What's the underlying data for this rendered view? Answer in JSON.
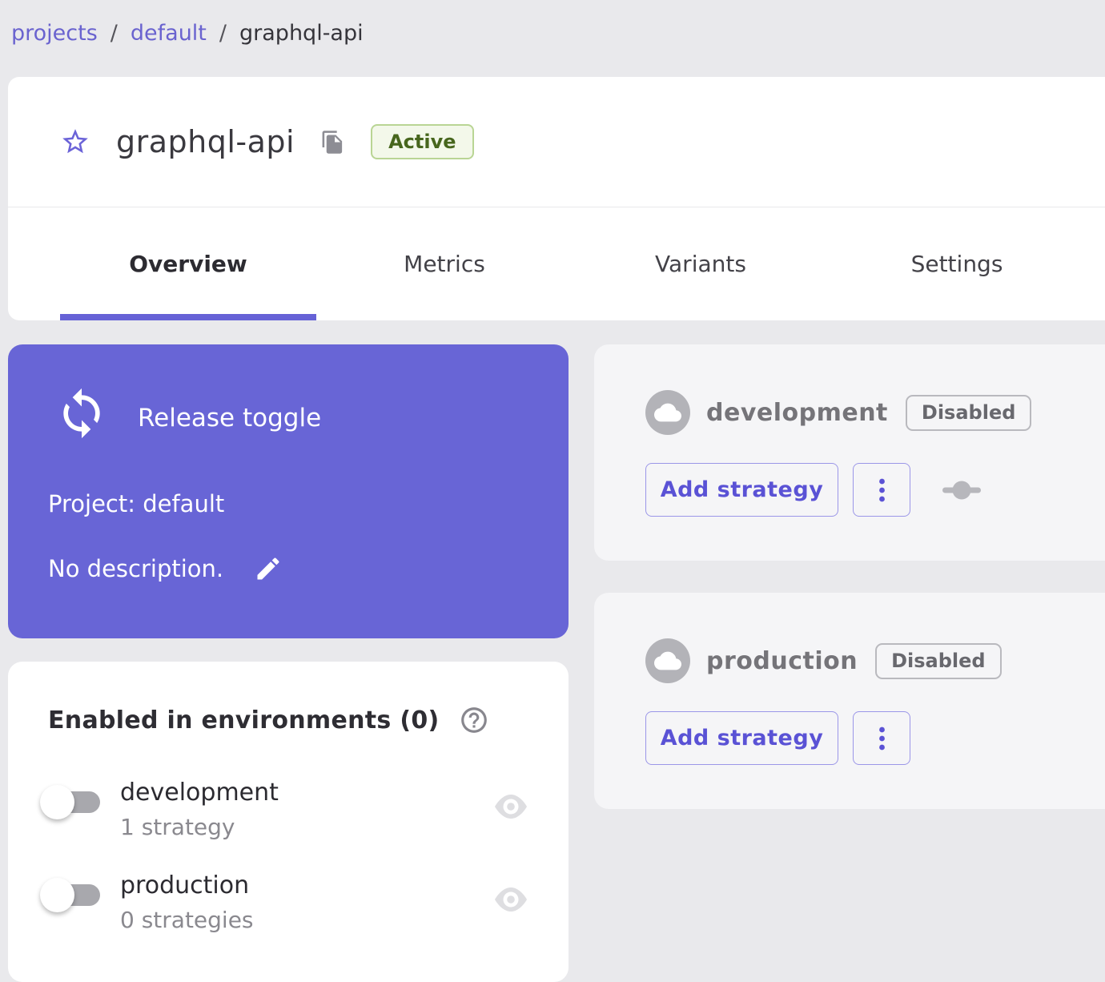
{
  "colors": {
    "page_bg": "#e9e9ec",
    "primary_purple": "#6865d6",
    "link_purple": "#6a63cf",
    "button_purple": "#5a52d5",
    "active_badge_text": "#47661d",
    "active_badge_bg": "#f3f8ea",
    "active_badge_border": "#b9d594"
  },
  "breadcrumb": {
    "separator": "/",
    "items": [
      {
        "label": "projects"
      },
      {
        "label": "default"
      },
      {
        "label": "graphql-api"
      }
    ]
  },
  "header": {
    "title": "graphql-api",
    "status_badge": "Active",
    "icons": {
      "favorite": "star-outline-icon",
      "copy": "copy-icon"
    }
  },
  "tabs": [
    {
      "label": "Overview"
    },
    {
      "label": "Metrics"
    },
    {
      "label": "Variants"
    },
    {
      "label": "Settings"
    }
  ],
  "overview_card": {
    "type_label": "Release toggle",
    "project_label": "Project: default",
    "description": "No description.",
    "icons": {
      "type": "cycle-arrows-icon",
      "edit": "pencil-icon"
    }
  },
  "env_cards": [
    {
      "name": "development",
      "status": "Disabled",
      "add_button": "Add strategy",
      "icons": {
        "avatar": "cloud-icon",
        "menu": "kebab-icon",
        "extra": "strategy-slider-icon"
      }
    },
    {
      "name": "production",
      "status": "Disabled",
      "add_button": "Add strategy",
      "icons": {
        "avatar": "cloud-icon",
        "menu": "kebab-icon"
      }
    }
  ],
  "enabled_panel": {
    "title": "Enabled in environments (0)",
    "help_icon": "help-icon",
    "rows": [
      {
        "name": "development",
        "strategies": "1 strategy",
        "toggle": "off",
        "icon": "eye-icon"
      },
      {
        "name": "production",
        "strategies": "0 strategies",
        "toggle": "off",
        "icon": "eye-icon"
      }
    ]
  }
}
